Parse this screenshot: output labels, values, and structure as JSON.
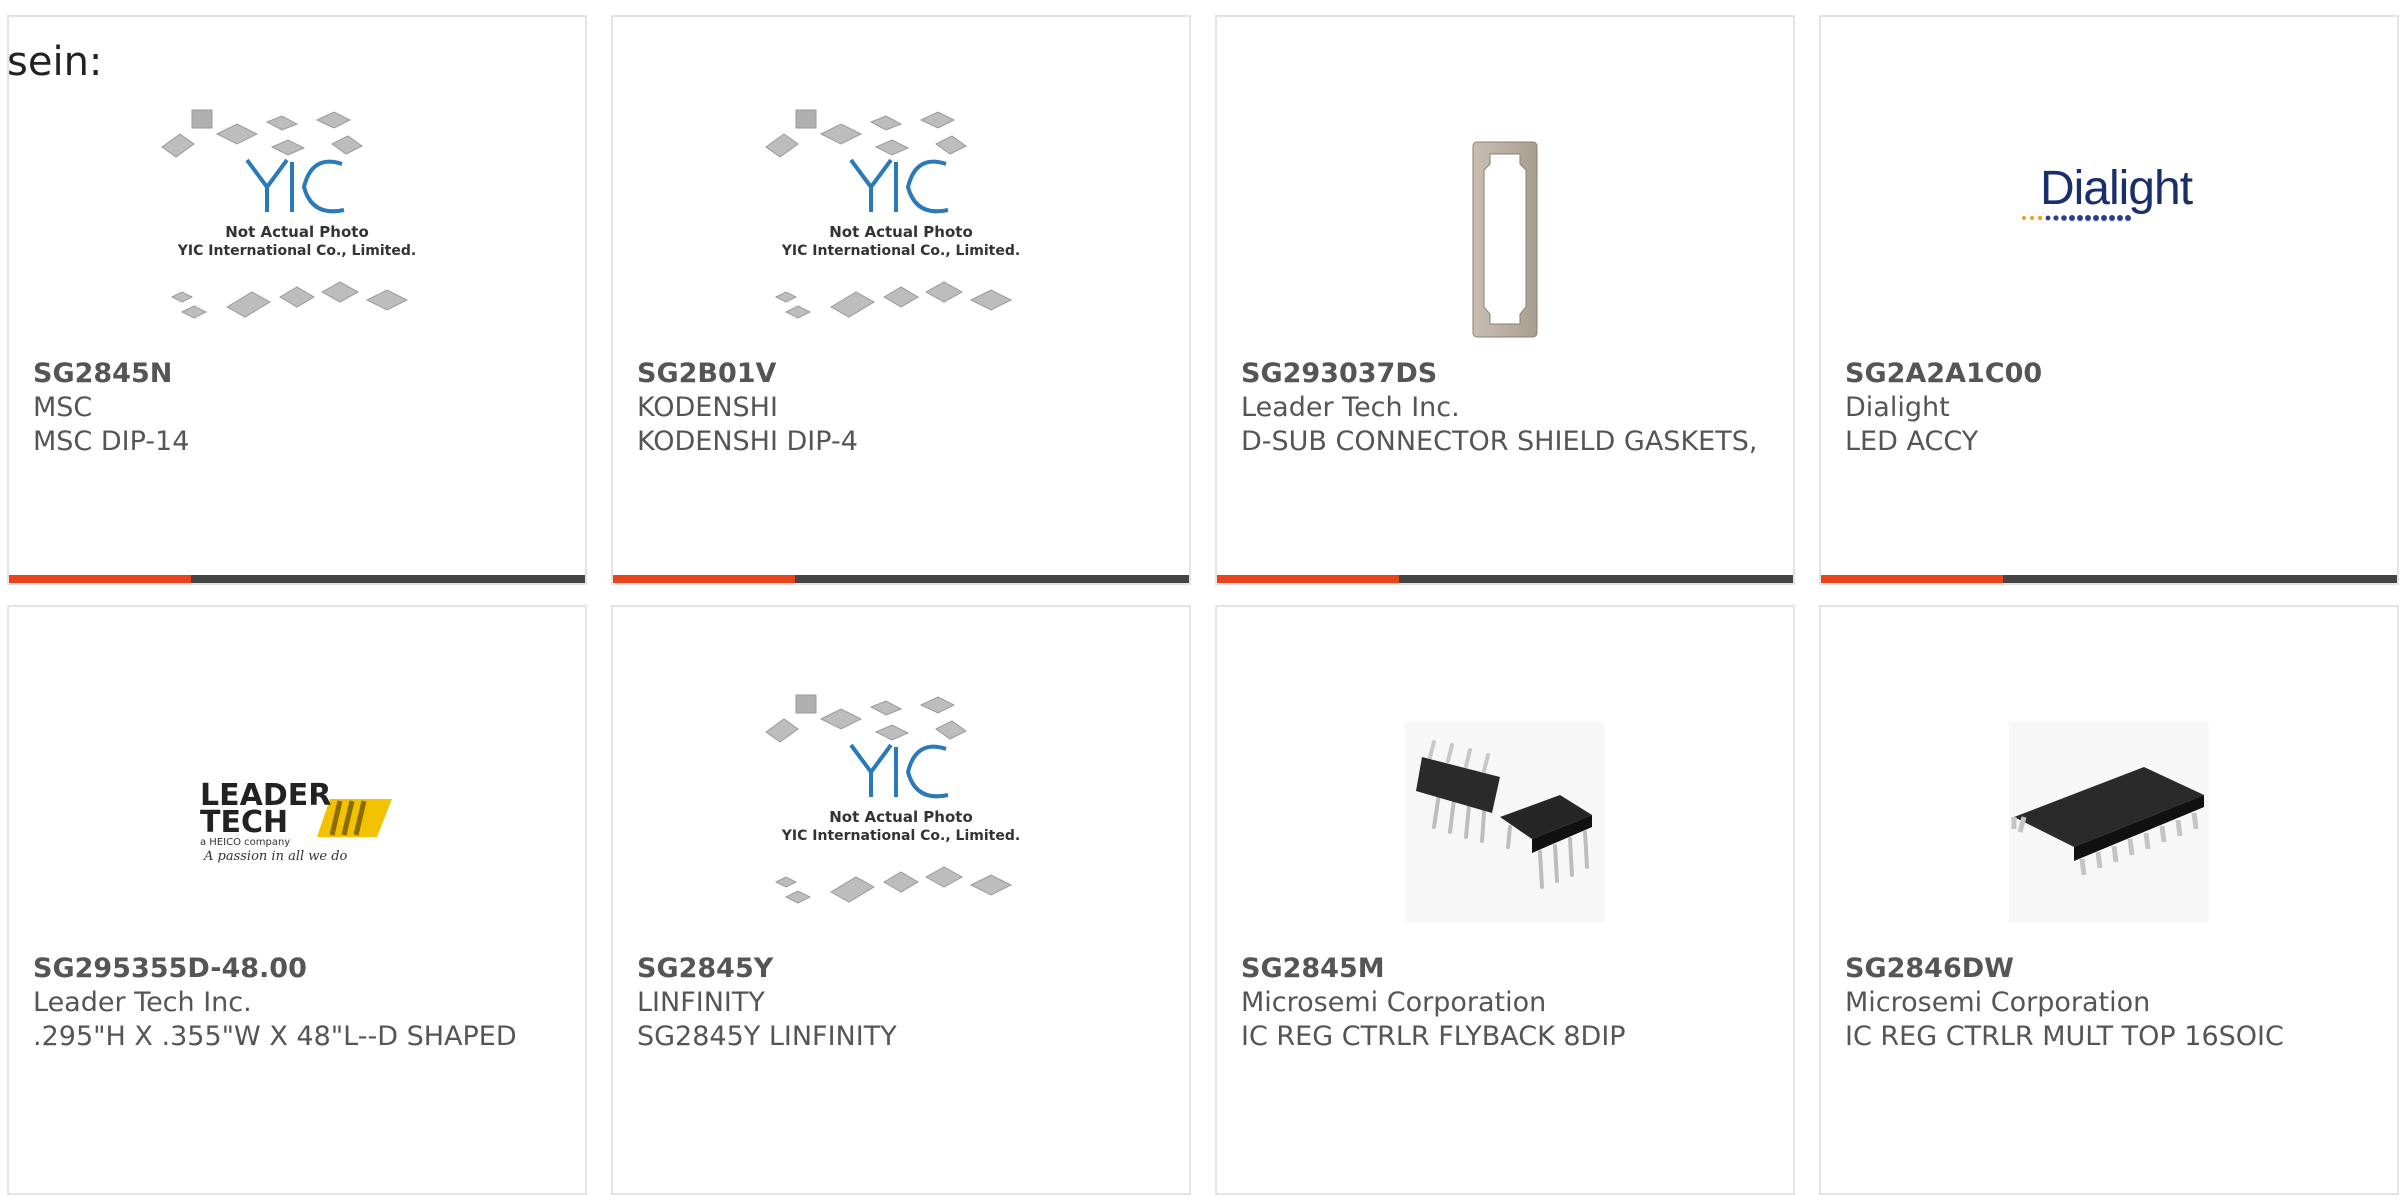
{
  "intro": "sein:",
  "products": [
    {
      "part": "SG2845N",
      "manufacturer": "MSC",
      "description": "MSC DIP-14",
      "image": "yic-placeholder",
      "image_text": [
        "Not Actual Photo",
        "YIC International Co., Limited."
      ]
    },
    {
      "part": "SG2B01V",
      "manufacturer": "KODENSHI",
      "description": "KODENSHI DIP-4",
      "image": "yic-placeholder",
      "image_text": [
        "Not Actual Photo",
        "YIC International Co., Limited."
      ]
    },
    {
      "part": "SG293037DS",
      "manufacturer": "Leader Tech Inc.",
      "description": "D-SUB CONNECTOR SHIELD GASKETS,",
      "image": "gasket-photo"
    },
    {
      "part": "SG2A2A1C00",
      "manufacturer": "Dialight",
      "description": "LED ACCY",
      "image": "dialight-logo",
      "image_text": [
        "Dialight"
      ]
    },
    {
      "part": "SG295355D-48.00",
      "manufacturer": "Leader Tech Inc.",
      "description": ".295\"H X .355\"W X 48\"L--D SHAPED",
      "image": "leadertech-logo",
      "image_text": [
        "LEADER",
        "TECH",
        "a HEICO company",
        "A passion in all we do"
      ]
    },
    {
      "part": "SG2845Y",
      "manufacturer": "LINFINITY",
      "description": "SG2845Y LINFINITY",
      "image": "yic-placeholder",
      "image_text": [
        "Not Actual Photo",
        "YIC International Co., Limited."
      ]
    },
    {
      "part": "SG2845M",
      "manufacturer": "Microsemi Corporation",
      "description": "IC REG CTRLR FLYBACK 8DIP",
      "image": "dip8-photo"
    },
    {
      "part": "SG2846DW",
      "manufacturer": "Microsemi Corporation",
      "description": "IC REG CTRLR MULT TOP 16SOIC",
      "image": "soic16-photo"
    }
  ],
  "colors": {
    "accent": "#e8441b",
    "bar": "#444444",
    "text": "#555555",
    "border": "#e3e3e3"
  }
}
